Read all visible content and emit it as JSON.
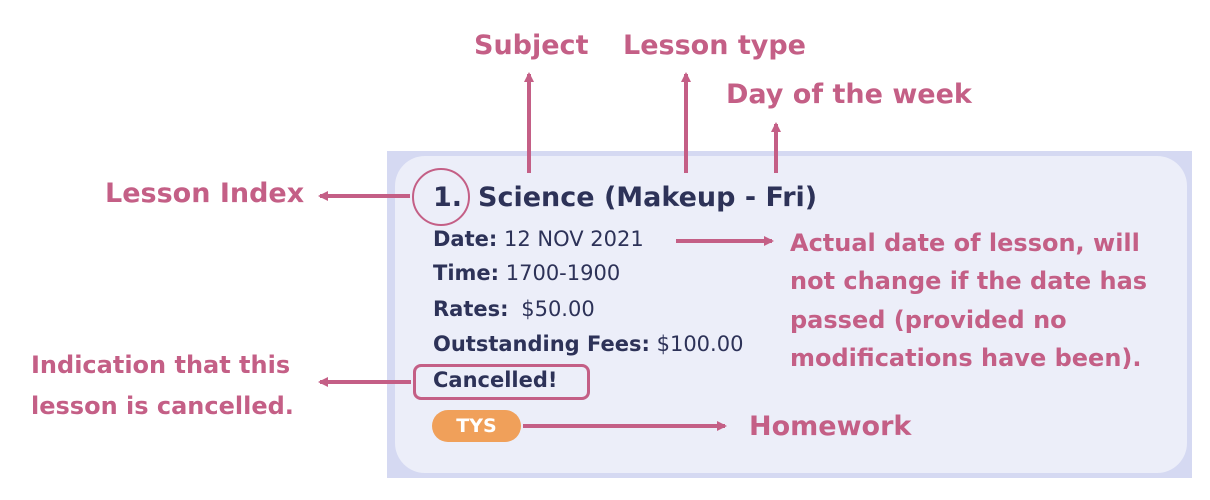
{
  "card": {
    "index": "1.",
    "title": "Science (Makeup - Fri)",
    "fields": [
      {
        "label": "Date:",
        "value": "12 NOV 2021"
      },
      {
        "label": "Time:",
        "value": "1700-1900"
      },
      {
        "label": "Rates:",
        "value": "$50.00"
      },
      {
        "label": "Outstanding Fees:",
        "value": "$100.00"
      }
    ],
    "status": "Cancelled!",
    "tag": "TYS"
  },
  "annotations": {
    "subject": "Subject",
    "lesson_type": "Lesson type",
    "day_of_week": "Day of the week",
    "lesson_index": "Lesson Index",
    "actual_date": [
      "Actual date of lesson, will",
      "not change if the date has",
      "passed (provided no",
      "modifications have been)."
    ],
    "cancelled": [
      "Indication that this",
      "lesson is cancelled."
    ],
    "homework": "Homework"
  },
  "colors": {
    "annotation": "#c45f86",
    "card_border": "#d5d9f2",
    "card_bg": "#eceef9",
    "card_text": "#2d3258",
    "tag_bg": "#f0a05a"
  }
}
